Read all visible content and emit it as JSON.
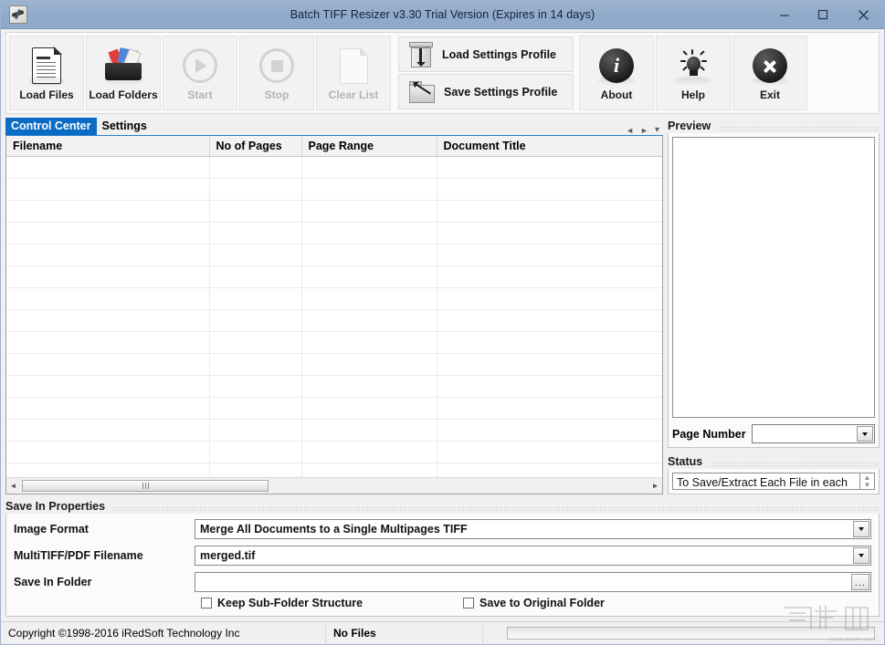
{
  "window": {
    "title": "Batch TIFF Resizer v3.30   Trial Version (Expires in 14 days)",
    "icon": "app-icon",
    "minimize_label": "–",
    "maximize_label": "□",
    "close_label": "✕"
  },
  "toolbar": {
    "buttons": [
      {
        "label": "Load Files",
        "icon": "document-icon",
        "enabled": true
      },
      {
        "label": "Load Folders",
        "icon": "folder-with-files-icon",
        "enabled": true
      },
      {
        "label": "Start",
        "icon": "play-circle-icon",
        "enabled": false
      },
      {
        "label": "Stop",
        "icon": "stop-circle-icon",
        "enabled": false
      },
      {
        "label": "Clear List",
        "icon": "blank-document-icon",
        "enabled": false
      }
    ],
    "profile_buttons": [
      {
        "label": "Load Settings Profile",
        "icon": "load-bin-icon"
      },
      {
        "label": "Save Settings Profile",
        "icon": "save-folder-pen-icon"
      }
    ],
    "right_buttons": [
      {
        "label": "About",
        "icon": "info-circle-icon"
      },
      {
        "label": "Help",
        "icon": "lightbulb-icon"
      },
      {
        "label": "Exit",
        "icon": "close-circle-icon"
      }
    ]
  },
  "tabs": {
    "items": [
      {
        "label": "Control Center",
        "active": true
      },
      {
        "label": "Settings",
        "active": false
      }
    ],
    "nav": {
      "prev": "◄",
      "next": "►",
      "list": "▾"
    }
  },
  "grid": {
    "columns": [
      "Filename",
      "No of Pages",
      "Page Range",
      "Document Title"
    ],
    "rows": [],
    "empty_row_count": 17,
    "hscroll": {
      "left_arrow": "◄",
      "right_arrow": "►",
      "thumb_grip": "III"
    }
  },
  "preview": {
    "title": "Preview",
    "page_number_label": "Page Number",
    "page_number_value": "",
    "page_number_placeholder": ""
  },
  "status_panel": {
    "title": "Status",
    "message": "To Save/Extract Each File in each row to their original filename, use one of the \"Extract\" Image Format. For Example, to save \"a.tif\" as \"a.tif\" and \"b.tif\" as \"b.tif\"",
    "scroll_up": "▲",
    "scroll_down": "▼"
  },
  "save_in_properties": {
    "title": "Save In Properties",
    "image_format": {
      "label": "Image Format",
      "value": "Merge All Documents to a Single Multipages TIFF"
    },
    "multitiff_filename": {
      "label": "MultiTIFF/PDF Filename",
      "value": "merged.tif"
    },
    "save_in_folder": {
      "label": "Save In Folder",
      "value": "",
      "browse_label": "..."
    },
    "checkboxes": [
      {
        "label": "Keep Sub-Folder Structure",
        "checked": false
      },
      {
        "label": "Save to Original Folder",
        "checked": false
      }
    ]
  },
  "statusbar": {
    "copyright": "Copyright ©1998-2016 iRedSoft Technology Inc",
    "file_count": "No Files",
    "progress_percent": 0,
    "watermark": "www.duote.com"
  },
  "colors": {
    "titlebar": "#92abcb",
    "active_tab": "#0a6cc4",
    "window_bg": "#f0f0f0",
    "grid_header": "#f2f2f2"
  }
}
